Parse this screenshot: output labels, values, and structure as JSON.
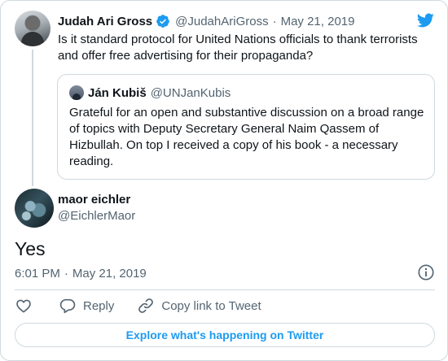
{
  "parent_tweet": {
    "author_name": "Judah Ari Gross",
    "author_handle": "@JudahAriGross",
    "separator": "·",
    "date": "May 21, 2019",
    "text": "Is it standard protocol for United Nations officials to thank terrorists and offer free advertising for their propaganda?",
    "verified_icon": "verified-badge-icon",
    "verified_color": "#1d9bf0"
  },
  "quoted_tweet": {
    "author_name": "Ján Kubiš",
    "author_handle": "@UNJanKubis",
    "text": "Grateful for an open and substantive  discussion on a broad range of topics with Deputy Secretary General Naim Qassem of Hizbullah. On top I received a copy of his book - a necessary reading."
  },
  "main_tweet": {
    "author_name": "maor eichler",
    "author_handle": "@EichlerMaor",
    "text": "Yes",
    "time": "6:01 PM",
    "separator": "·",
    "date": "May 21, 2019"
  },
  "actions": {
    "like_icon": "heart-icon",
    "reply_label": "Reply",
    "copy_link_label": "Copy link to Tweet"
  },
  "explore_label": "Explore what's happening on Twitter",
  "colors": {
    "brand": "#1d9bf0",
    "text": "#0f1419",
    "secondary": "#536471",
    "border": "#cfd9de"
  }
}
